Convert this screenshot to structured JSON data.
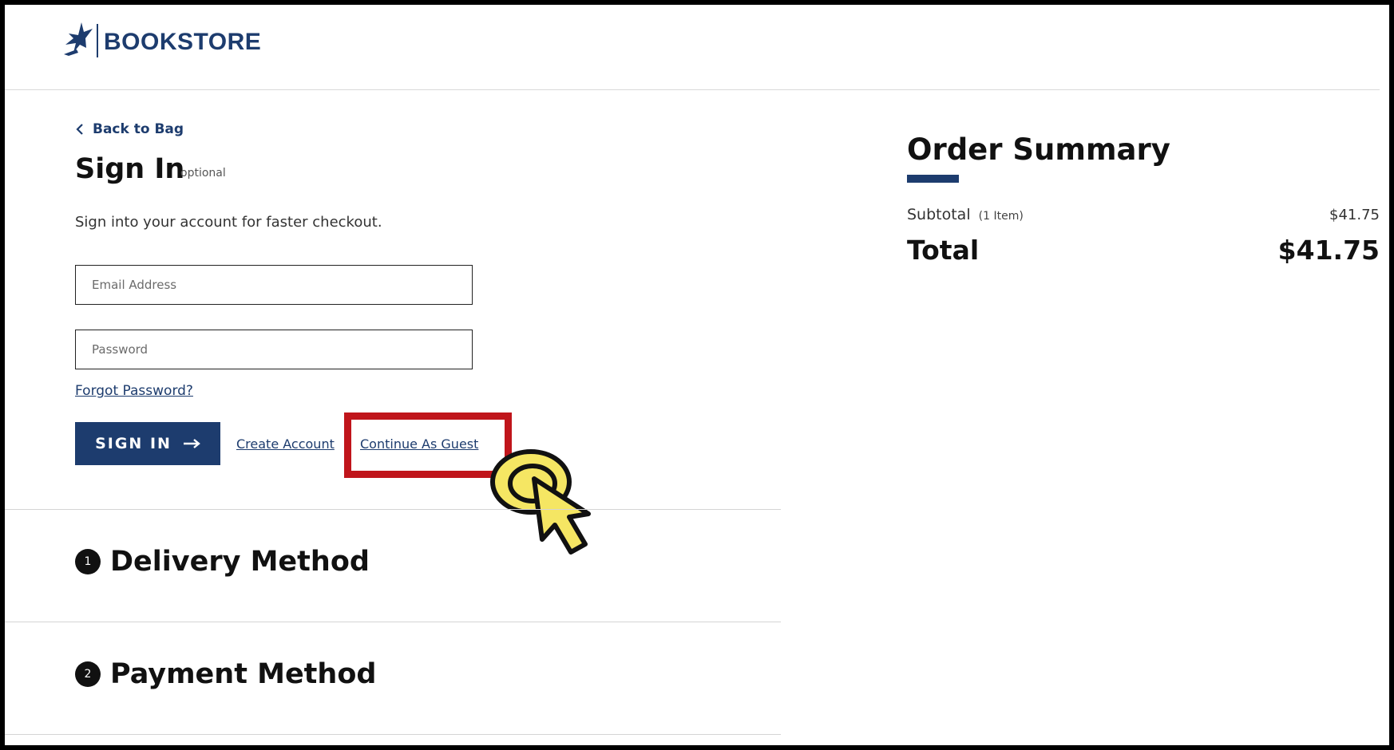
{
  "header": {
    "logo_text": "BOOKSTORE"
  },
  "nav": {
    "back_label": "Back to Bag"
  },
  "signin": {
    "title": "Sign In",
    "optional_label": "optional",
    "description": "Sign into your account for faster checkout.",
    "email_placeholder": "Email Address",
    "password_placeholder": "Password",
    "forgot_label": "Forgot Password?",
    "button_label": "SIGN IN",
    "create_account_label": "Create Account",
    "guest_label": "Continue As Guest"
  },
  "steps": [
    {
      "number": "1",
      "title": "Delivery Method"
    },
    {
      "number": "2",
      "title": "Payment Method"
    }
  ],
  "order_summary": {
    "title": "Order Summary",
    "subtotal_label": "Subtotal",
    "subtotal_count": "(1 Item)",
    "subtotal_value": "$41.75",
    "total_label": "Total",
    "total_value": "$41.75"
  },
  "colors": {
    "brand": "#1d3c6e",
    "highlight": "#c0151b",
    "cursor_fill": "#f5e663"
  },
  "icons": {
    "logo": "bird-logo-icon",
    "back": "chevron-left-icon",
    "button_arrow": "arrow-right-icon",
    "pointer": "click-pointer-icon"
  }
}
